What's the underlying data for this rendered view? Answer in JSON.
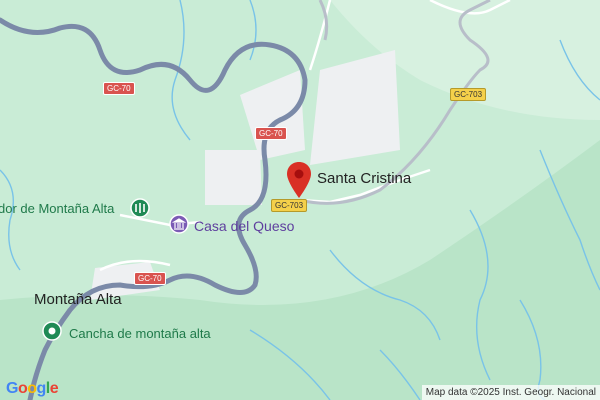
{
  "map": {
    "places": [
      {
        "id": "santa-cristina",
        "label": "Santa Cristina"
      },
      {
        "id": "montana-alta",
        "label": "Montaña Alta"
      }
    ],
    "pois": {
      "mirador": "dor de Montaña Alta",
      "casa_queso": "Casa del Queso",
      "cancha": "Cancha de montaña alta"
    },
    "roads": {
      "gc70_1": "GC-70",
      "gc70_2": "GC-70",
      "gc70_3": "GC-70",
      "gc703_1": "GC-703",
      "gc703_2": "GC-703"
    },
    "icons": {
      "pin": "map-pin-icon",
      "viewpoint": "viewpoint-icon",
      "museum": "museum-icon",
      "park": "park-icon"
    },
    "colors": {
      "land": "#c9ecd6",
      "urban": "#eef0f2",
      "road": "#7b8aa8",
      "water": "#79c3e8",
      "pin": "#d93025"
    }
  },
  "logo": "Google",
  "attribution": "Map data ©2025 Inst. Geogr. Nacional"
}
